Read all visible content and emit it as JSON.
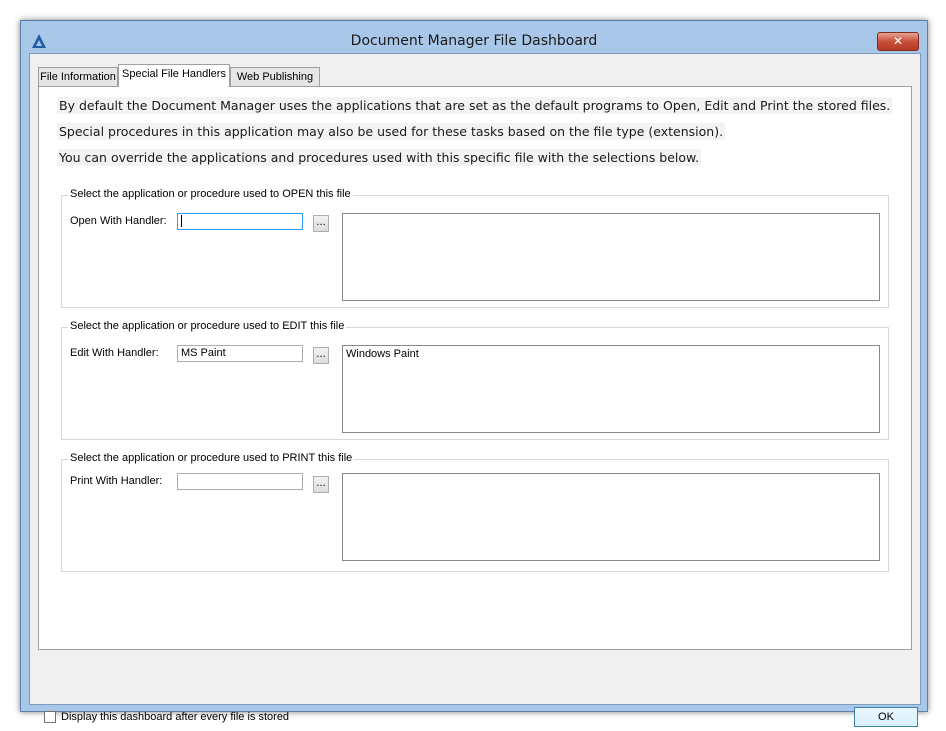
{
  "window": {
    "title": "Document Manager File Dashboard",
    "close_glyph": "✕"
  },
  "tabs": [
    {
      "label": "File Information",
      "active": false
    },
    {
      "label": "Special File Handlers",
      "active": true
    },
    {
      "label": "Web Publishing",
      "active": false
    }
  ],
  "intro": [
    "By default the Document Manager uses the applications that are set as the default programs to Open, Edit and Print the stored files.",
    "Special procedures in this application may also be used for these tasks based on the file type (extension).",
    "You can override the applications and procedures used with this specific file with the selections below."
  ],
  "groups": {
    "open": {
      "title": "Select the application or procedure used to OPEN this file",
      "label": "Open With Handler:",
      "value": "",
      "description": "",
      "browse": "..."
    },
    "edit": {
      "title": "Select the application or procedure used to EDIT this file",
      "label": "Edit With Handler:",
      "value": "MS Paint",
      "description": "Windows Paint",
      "browse": "..."
    },
    "print": {
      "title": "Select the application or procedure used to PRINT this file",
      "label": "Print With Handler:",
      "value": "",
      "description": "",
      "browse": "..."
    }
  },
  "footer": {
    "checkbox_label": "Display this dashboard after every file is stored",
    "checkbox_checked": false,
    "ok_label": "OK"
  },
  "colors": {
    "title_bar": "#a9c7e8",
    "close_button": "#c7503a"
  }
}
